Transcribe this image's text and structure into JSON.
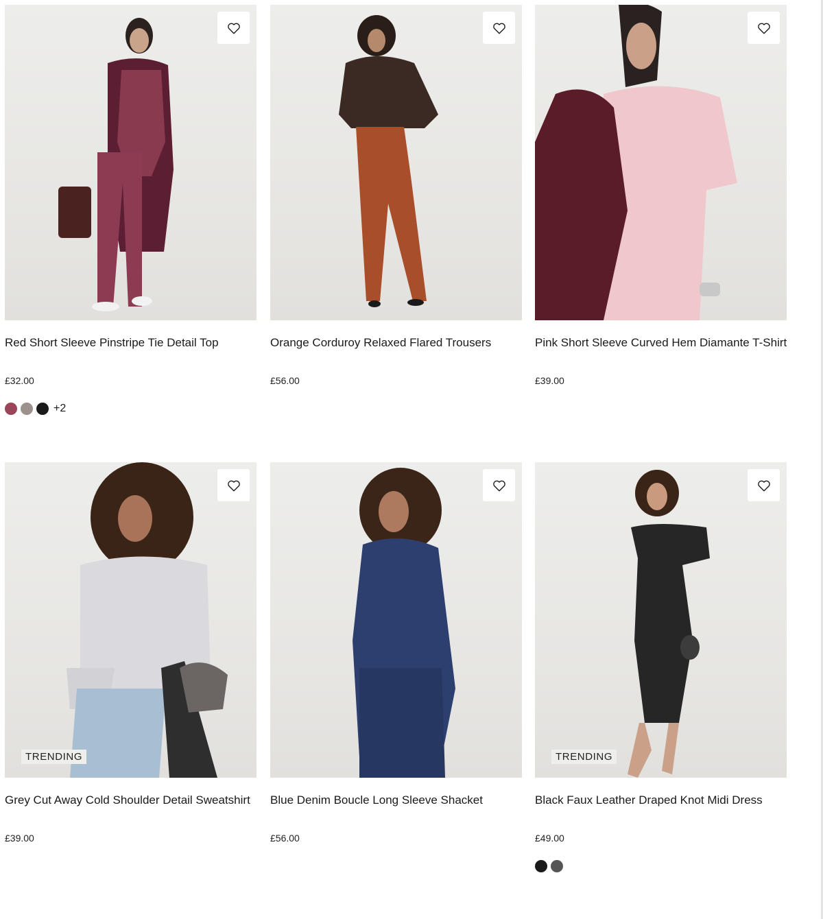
{
  "products": [
    {
      "name": "Red Short Sleeve Pinstripe Tie Detail Top",
      "price": "£32.00",
      "badge": "",
      "colors": [
        "#9a4558",
        "#9c918c",
        "#1a1a1a"
      ],
      "more_colors": "+2",
      "image_icon": "model-photo"
    },
    {
      "name": "Orange Corduroy Relaxed Flared Trousers",
      "price": "£56.00",
      "badge": "",
      "colors": [],
      "more_colors": "",
      "image_icon": "model-photo"
    },
    {
      "name": "Pink Short Sleeve Curved Hem Diamante T-Shirt",
      "price": "£39.00",
      "badge": "",
      "colors": [],
      "more_colors": "",
      "image_icon": "model-photo"
    },
    {
      "name": "Grey Cut Away Cold Shoulder Detail Sweatshirt",
      "price": "£39.00",
      "badge": "TRENDING",
      "colors": [],
      "more_colors": "",
      "image_icon": "model-photo"
    },
    {
      "name": "Blue Denim Boucle Long Sleeve Shacket",
      "price": "£56.00",
      "badge": "",
      "colors": [],
      "more_colors": "",
      "image_icon": "model-photo"
    },
    {
      "name": "Black Faux Leather Draped Knot Midi Dress",
      "price": "£49.00",
      "badge": "TRENDING",
      "colors": [
        "#1a1a1a",
        "#555555"
      ],
      "more_colors": "",
      "image_icon": "model-photo"
    }
  ],
  "wishlist_icon": "heart-outline-icon"
}
